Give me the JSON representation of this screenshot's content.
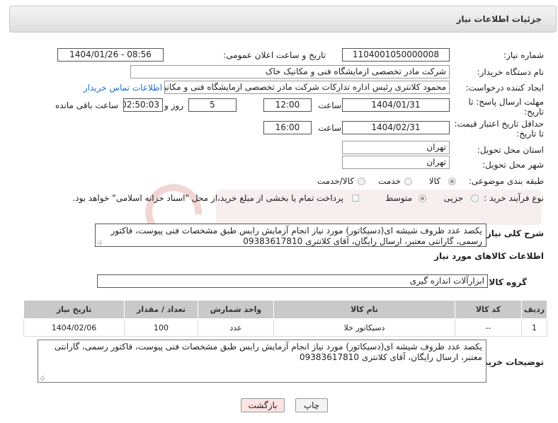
{
  "header": {
    "title": "جزئیات اطلاعات نیاز"
  },
  "form": {
    "need_number": {
      "label": "شماره نیاز:",
      "value": "1104001050000008"
    },
    "announce_datetime": {
      "label": "تاریخ و ساعت اعلان عمومی:",
      "value": "1404/01/26 - 08:56"
    },
    "buyer_org": {
      "label": "نام دستگاه خریدار:",
      "value": "شرکت مادر تخصصی ازمایشگاه فنی و مکانیک خاک"
    },
    "requester": {
      "label": "ایجاد کننده درخواست:",
      "value": "محمود کلانتری رئیس اداره تدارکات شرکت مادر تخصصی ازمایشگاه فنی و مکانیک",
      "contact_link": "اطلاعات تماس خریدار"
    },
    "reply_deadline": {
      "label_line1": "مهلت ارسال پاسخ: تا",
      "label_line2": "تاریخ:",
      "date": "1404/01/31",
      "time_label": "ساعت",
      "time": "12:00",
      "days": "5",
      "days_label": "روز و",
      "remaining": "02:50:03",
      "remaining_label": "ساعت باقی مانده"
    },
    "price_validity": {
      "label_line1": "حداقل تاریخ اعتبار قیمت:",
      "label_line2": "تا تاریخ:",
      "date": "1404/02/31",
      "time_label": "ساعت",
      "time": "16:00"
    },
    "delivery_province": {
      "label": "استان محل تحویل:",
      "value": "تهران"
    },
    "delivery_city": {
      "label": "شهر محل تحویل:",
      "value": "تهران"
    },
    "category": {
      "label": "طبقه بندی موضوعی:",
      "options": [
        "کالا",
        "خدمت",
        "کالا/خدمت"
      ],
      "selected": "کالا"
    },
    "purchase_process": {
      "label": "نوع فرآیند خرید :",
      "options": [
        "جزیی",
        "متوسط"
      ],
      "selected": "متوسط",
      "payment_note": "پرداخت تمام یا بخشی از مبلغ خرید،از محل \"اسناد خزانه اسلامی\" خواهد بود."
    },
    "general_description": {
      "label": "شرح کلی نیاز:",
      "value": "یکصد عدد ظروف شیشه ای(دسیکاتور) مورد نیاز انجام آزمایش رایس طبق مشخصات فنی پیوست، فاکتور رسمی، گارانتی معتبر، ارسال رایگان، آقای کلانتری 09383617810"
    }
  },
  "goods": {
    "section_title": "اطلاعات کالاهای مورد نیاز",
    "group_label": "گروه کالا:",
    "group_value": "ابزارآلات اندازه گیری",
    "columns": [
      "ردیف",
      "کد کالا",
      "نام کالا",
      "واحد شمارش",
      "تعداد / مقدار",
      "تاریخ نیاز"
    ],
    "rows": [
      [
        "1",
        "--",
        "دسیکاتور خلا",
        "عدد",
        "100",
        "1404/02/06"
      ]
    ]
  },
  "buyer_notes": {
    "label": "توضیحات خریدار:",
    "value": "یکصد عدد ظروف شیشه ای(دسیکاتور) مورد نیاز انجام آزمایش رایس طبق مشخصات فنی پیوست، فاکتور رسمی، گارانتی معتبر، ارسال رایگان، آقای کلانتری 09383617810"
  },
  "buttons": {
    "print": "چاپ",
    "back": "بازگشت"
  },
  "colors": {
    "link": "#1d6fd1",
    "back_button_bg": "#fde3e3",
    "table_header_bg": "#c9c9c9"
  }
}
